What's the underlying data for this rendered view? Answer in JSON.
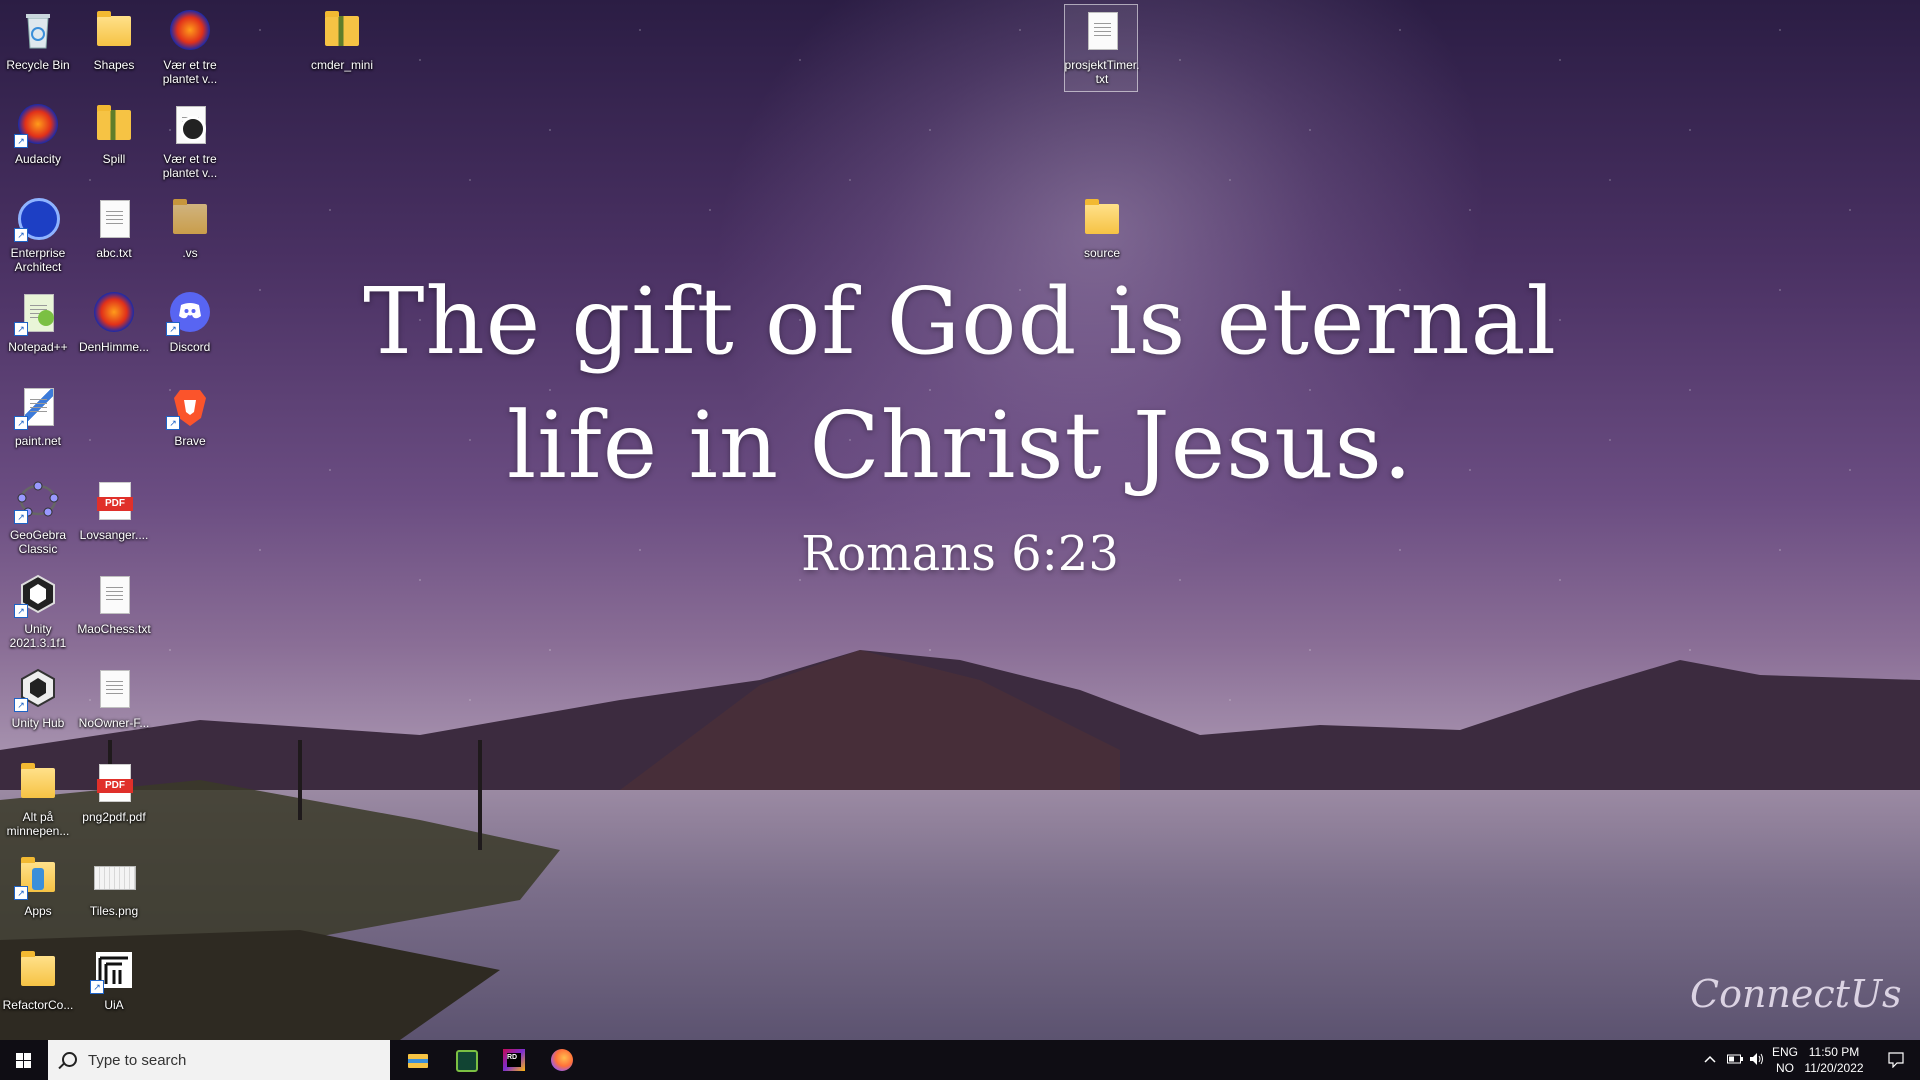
{
  "wallpaper": {
    "verse_line1": "The gift of God is eternal",
    "verse_line2": "life in Christ Jesus.",
    "reference": "Romans 6:23",
    "signature": "ConnectUs"
  },
  "desktop_icons": [
    {
      "label": "Recycle Bin",
      "icon": "recycle-bin-icon"
    },
    {
      "label": "Shapes",
      "icon": "folder-icon"
    },
    {
      "label": "Vær et tre plantet v...",
      "icon": "audacity-project-icon"
    },
    {
      "label": "cmder_mini",
      "icon": "zip-folder-icon"
    },
    {
      "label": "prosjektTimer.txt",
      "icon": "text-file-icon"
    },
    {
      "label": "Audacity",
      "icon": "audacity-icon"
    },
    {
      "label": "Spill",
      "icon": "zip-folder-icon"
    },
    {
      "label": "Vær et tre plantet v...",
      "icon": "audio-file-icon"
    },
    {
      "label": "Enterprise Architect",
      "icon": "enterprise-architect-icon"
    },
    {
      "label": "abc.txt",
      "icon": "text-file-icon"
    },
    {
      "label": ".vs",
      "icon": "folder-icon"
    },
    {
      "label": "source",
      "icon": "folder-icon"
    },
    {
      "label": "Notepad++",
      "icon": "notepad-plus-plus-icon"
    },
    {
      "label": "DenHimme...",
      "icon": "audacity-project-icon"
    },
    {
      "label": "Discord",
      "icon": "discord-icon"
    },
    {
      "label": "paint.net",
      "icon": "paint-net-icon"
    },
    {
      "label": "Brave",
      "icon": "brave-icon"
    },
    {
      "label": "GeoGebra Classic",
      "icon": "geogebra-icon"
    },
    {
      "label": "Lovsanger....",
      "icon": "pdf-icon"
    },
    {
      "label": "Unity 2021.3.1f1",
      "icon": "unity-icon"
    },
    {
      "label": "MaoChess.txt",
      "icon": "text-file-icon"
    },
    {
      "label": "Unity Hub",
      "icon": "unity-hub-icon"
    },
    {
      "label": "NoOwner-F...",
      "icon": "text-file-icon"
    },
    {
      "label": "Alt på minnepen...",
      "icon": "folder-icon"
    },
    {
      "label": "png2pdf.pdf",
      "icon": "pdf-icon"
    },
    {
      "label": "Apps",
      "icon": "apps-folder-icon"
    },
    {
      "label": "Tiles.png",
      "icon": "image-file-icon"
    },
    {
      "label": "RefactorCo...",
      "icon": "folder-icon"
    },
    {
      "label": "UiA",
      "icon": "uia-icon"
    }
  ],
  "taskbar": {
    "search_placeholder": "Type to search",
    "apps": [
      {
        "name": "File Explorer",
        "icon": "file-explorer-icon"
      },
      {
        "name": "Enterprise Architect",
        "icon": "ea-taskbar-icon"
      },
      {
        "name": "Rider",
        "icon": "rider-icon"
      },
      {
        "name": "Firefox",
        "icon": "firefox-icon"
      }
    ],
    "tray": {
      "language_line1": "ENG",
      "language_line2": "NO",
      "time": "11:50 PM",
      "date": "11/20/2022"
    }
  }
}
